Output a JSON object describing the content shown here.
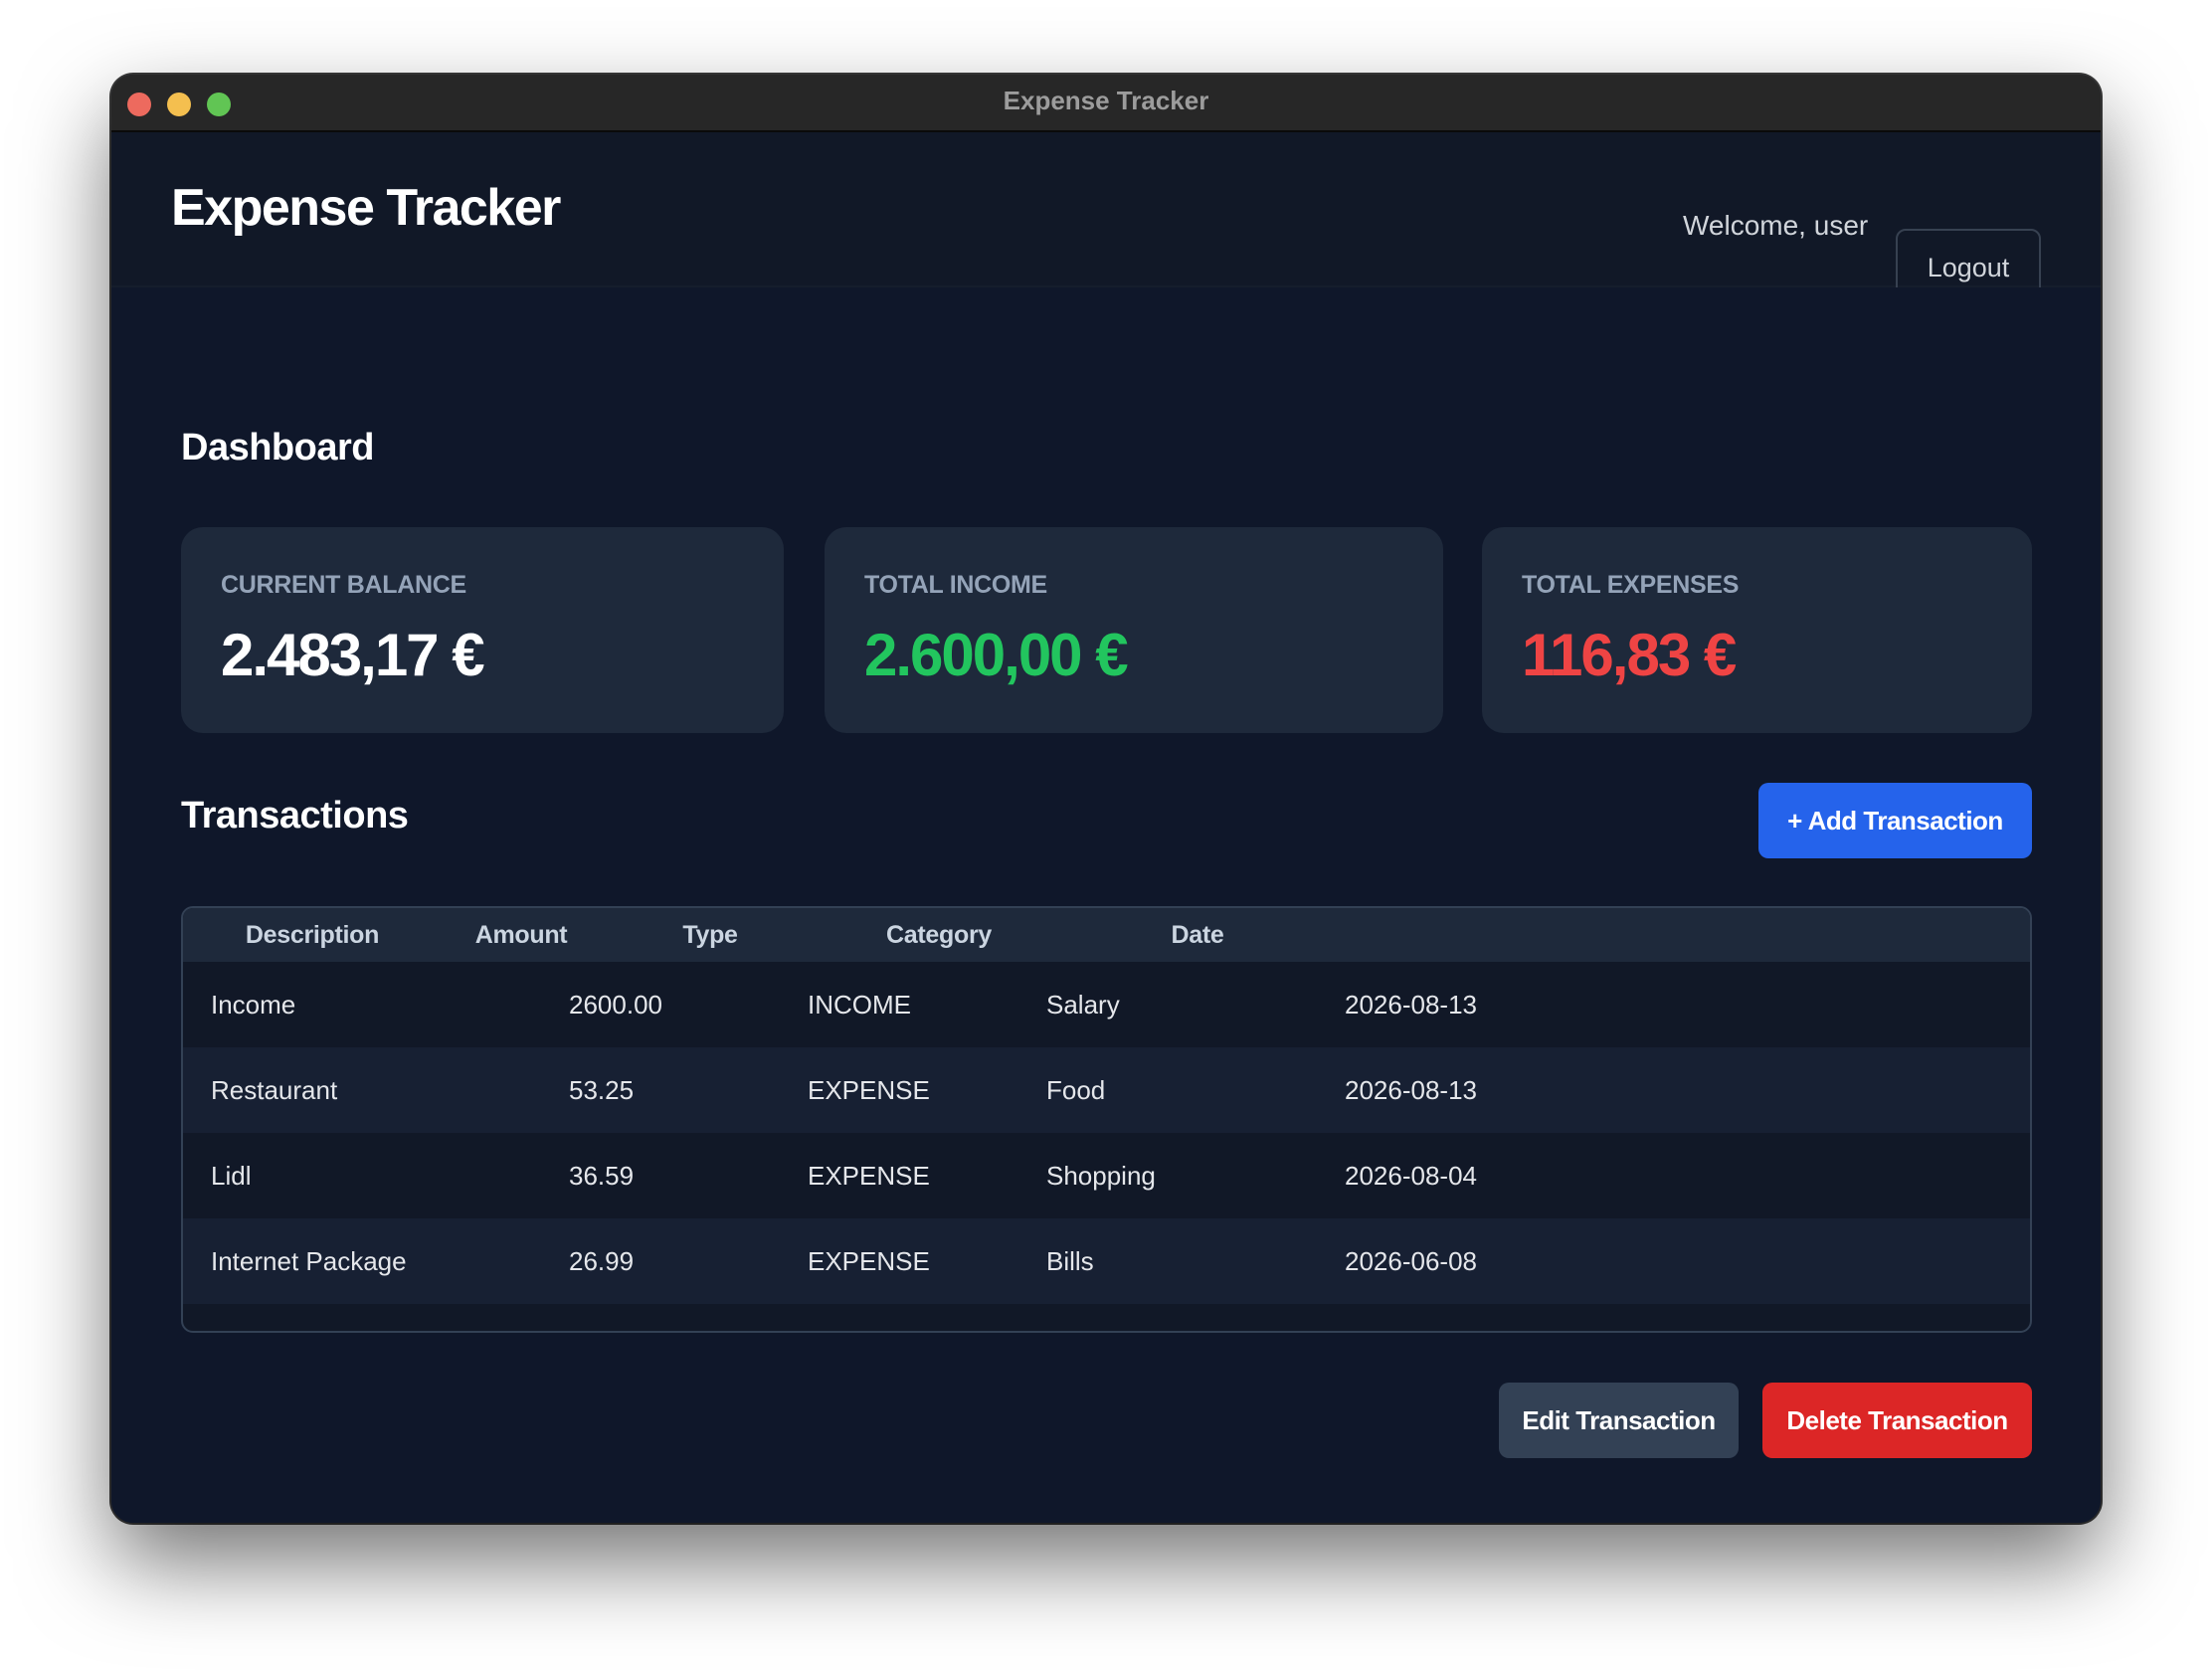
{
  "window": {
    "title": "Expense Tracker"
  },
  "header": {
    "app_title": "Expense Tracker",
    "welcome": "Welcome, user",
    "logout_label": "Logout"
  },
  "dashboard": {
    "title": "Dashboard",
    "cards": [
      {
        "label": "CURRENT BALANCE",
        "value": "2.483,17 €",
        "color": "#ffffff"
      },
      {
        "label": "TOTAL INCOME",
        "value": "2.600,00 €",
        "color": "#22c55e"
      },
      {
        "label": "TOTAL EXPENSES",
        "value": "116,83 €",
        "color": "#ef4444"
      }
    ]
  },
  "transactions": {
    "title": "Transactions",
    "add_label": "+ Add Transaction",
    "columns": [
      "Description",
      "Amount",
      "Type",
      "Category",
      "Date"
    ],
    "rows": [
      {
        "description": "Income",
        "amount": "2600.00",
        "type": "INCOME",
        "category": "Salary",
        "date": "2026-08-13"
      },
      {
        "description": "Restaurant",
        "amount": "53.25",
        "type": "EXPENSE",
        "category": "Food",
        "date": "2026-08-13"
      },
      {
        "description": "Lidl",
        "amount": "36.59",
        "type": "EXPENSE",
        "category": "Shopping",
        "date": "2026-08-04"
      },
      {
        "description": "Internet Package",
        "amount": "26.99",
        "type": "EXPENSE",
        "category": "Bills",
        "date": "2026-06-08"
      }
    ],
    "edit_label": "Edit Transaction",
    "delete_label": "Delete Transaction"
  },
  "colors": {
    "accent": "#2563eb",
    "danger": "#dc2626",
    "income": "#22c55e",
    "expense": "#ef4444",
    "background": "#0f172a",
    "card": "#1e293b"
  }
}
